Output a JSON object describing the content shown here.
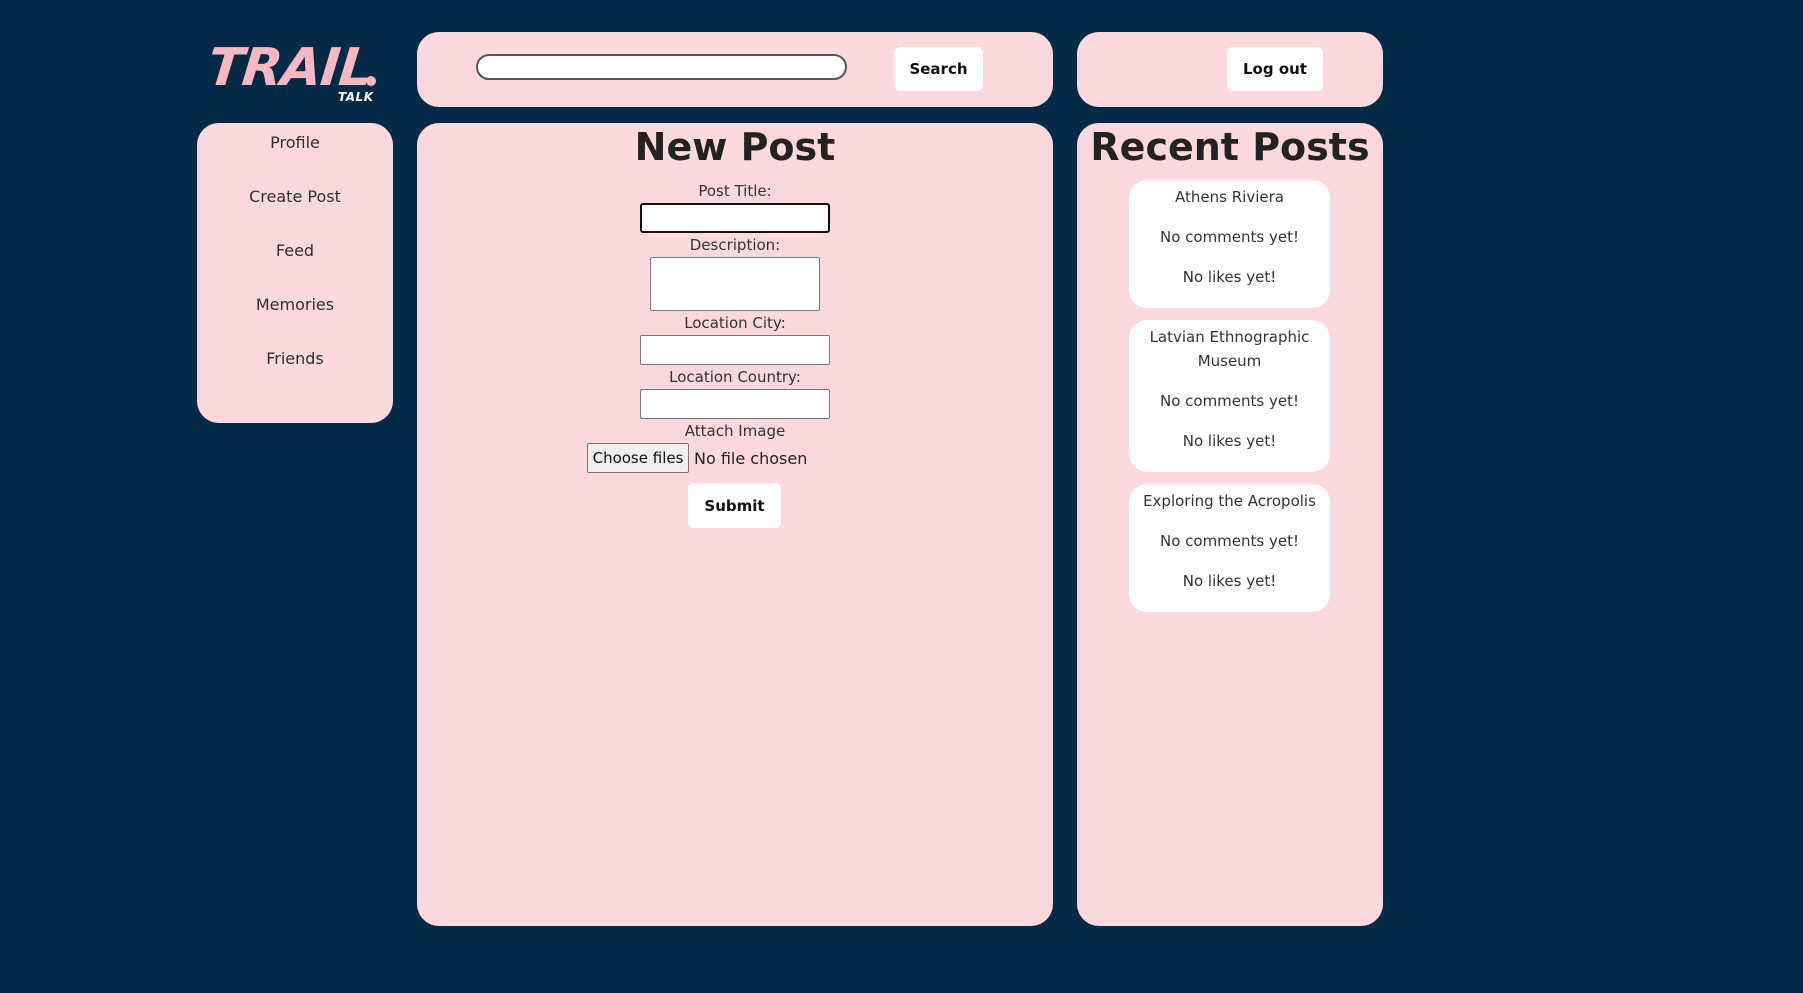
{
  "logo": {
    "main": "TRAIL",
    "sub": "TALK"
  },
  "search": {
    "placeholder": "",
    "button_label": "Search"
  },
  "auth": {
    "logout_label": "Log out"
  },
  "sidebar": {
    "items": [
      {
        "label": "Profile"
      },
      {
        "label": "Create Post"
      },
      {
        "label": "Feed"
      },
      {
        "label": "Memories"
      },
      {
        "label": "Friends"
      }
    ]
  },
  "new_post": {
    "heading": "New Post",
    "title_label": "Post Title:",
    "title_value": "",
    "description_label": "Description:",
    "description_value": "",
    "city_label": "Location City:",
    "city_value": "",
    "country_label": "Location Country:",
    "country_value": "",
    "image_label": "Attach Image",
    "choose_files_label": "Choose files",
    "no_file_text": "No file chosen",
    "submit_label": "Submit"
  },
  "recent_posts": {
    "heading": "Recent Posts",
    "posts": [
      {
        "title": "Athens Riviera",
        "comments": "No comments yet!",
        "likes": "No likes yet!"
      },
      {
        "title": "Latvian Ethnographic Museum",
        "comments": "No comments yet!",
        "likes": "No likes yet!"
      },
      {
        "title": "Exploring the Acropolis",
        "comments": "No comments yet!",
        "likes": "No likes yet!"
      }
    ]
  },
  "colors": {
    "background": "#052a47",
    "panel": "#fbd9dc",
    "logo": "#f7b8c2"
  }
}
